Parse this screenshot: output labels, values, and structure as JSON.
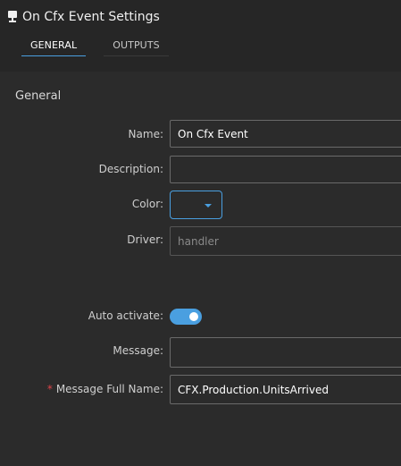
{
  "window": {
    "title": "On Cfx Event Settings",
    "icon": "monitor-icon"
  },
  "tabs": [
    {
      "label": "GENERAL",
      "active": true
    },
    {
      "label": "OUTPUTS",
      "active": false
    }
  ],
  "section": {
    "title": "General"
  },
  "fields": {
    "name": {
      "label": "Name:",
      "value": "On Cfx Event"
    },
    "description": {
      "label": "Description:",
      "value": ""
    },
    "color": {
      "label": "Color:",
      "value": ""
    },
    "driver": {
      "label": "Driver:",
      "placeholder": "handler"
    },
    "auto_activate": {
      "label": "Auto activate:",
      "enabled": true
    },
    "message": {
      "label": "Message:",
      "value": ""
    },
    "message_full_name": {
      "label": "Message Full Name:",
      "required_mark": "*",
      "value": "CFX.Production.UnitsArrived"
    }
  },
  "colors": {
    "accent": "#4a9fe0",
    "required": "#e0444a",
    "background": "#2b2b2b",
    "header": "#262626"
  }
}
